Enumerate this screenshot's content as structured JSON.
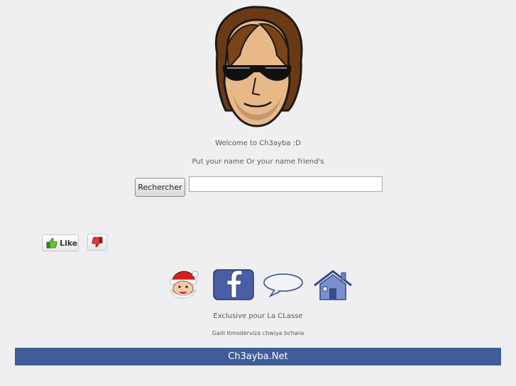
{
  "header": {
    "avatar_icon": "cartoon-man-sunglasses",
    "welcome_text": "Welcome to Ch3ayba :D",
    "prompt_text": "Put your name Or your name friend's"
  },
  "search": {
    "button_label": "Rechercher",
    "input_value": "",
    "placeholder": ""
  },
  "reactions": {
    "like_label": "Like",
    "like_icon": "thumbs-up-icon",
    "dislike_icon": "thumbs-down-icon"
  },
  "nav_icons": [
    "santa-icon",
    "facebook-icon",
    "chat-bubble-icon",
    "home-icon"
  ],
  "footer": {
    "exclusive_text": "Exclusive pour La CLasse",
    "note_text": "Gadi Itmoderviza chwiya bchwia",
    "bar_text": "Ch3ayba.Net"
  },
  "colors": {
    "background": "#efeff1",
    "footer_bar": "#3f5d99",
    "facebook_blue": "#3b4f9a",
    "text_gray": "#5a5a5a"
  }
}
